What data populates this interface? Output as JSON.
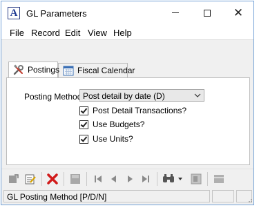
{
  "window": {
    "title": "GL Parameters",
    "icon": "a-logo-icon",
    "controls": [
      "minimize-icon",
      "maximize-icon",
      "close-icon"
    ]
  },
  "menu": [
    "File",
    "Record",
    "Edit",
    "View",
    "Help"
  ],
  "tabs": [
    {
      "label": "Postings",
      "icon": "tools-icon",
      "active": true
    },
    {
      "label": "Fiscal Calendar",
      "icon": "calendar-icon",
      "active": false
    }
  ],
  "postings": {
    "posting_method_label": "Posting Method:",
    "posting_method_value": "Post detail by date (D)",
    "checkboxes": [
      {
        "label": "Post Detail Transactions?",
        "checked": true
      },
      {
        "label": "Use Budgets?",
        "checked": true
      },
      {
        "label": "Use Units?",
        "checked": true
      }
    ]
  },
  "toolbar": {
    "buttons": [
      "new-record-icon",
      "edit-record-icon",
      "delete-icon",
      "save-icon",
      "first-record-icon",
      "previous-record-icon",
      "next-record-icon",
      "last-record-icon",
      "find-icon",
      "find-dropdown-icon",
      "lookup-icon",
      "view-icon"
    ]
  },
  "status": {
    "message": "GL Posting Method [P/D/N]"
  },
  "colors": {
    "accent": "#1f3a93",
    "delete": "#d11a1a",
    "window_border": "#6f9fd6"
  }
}
